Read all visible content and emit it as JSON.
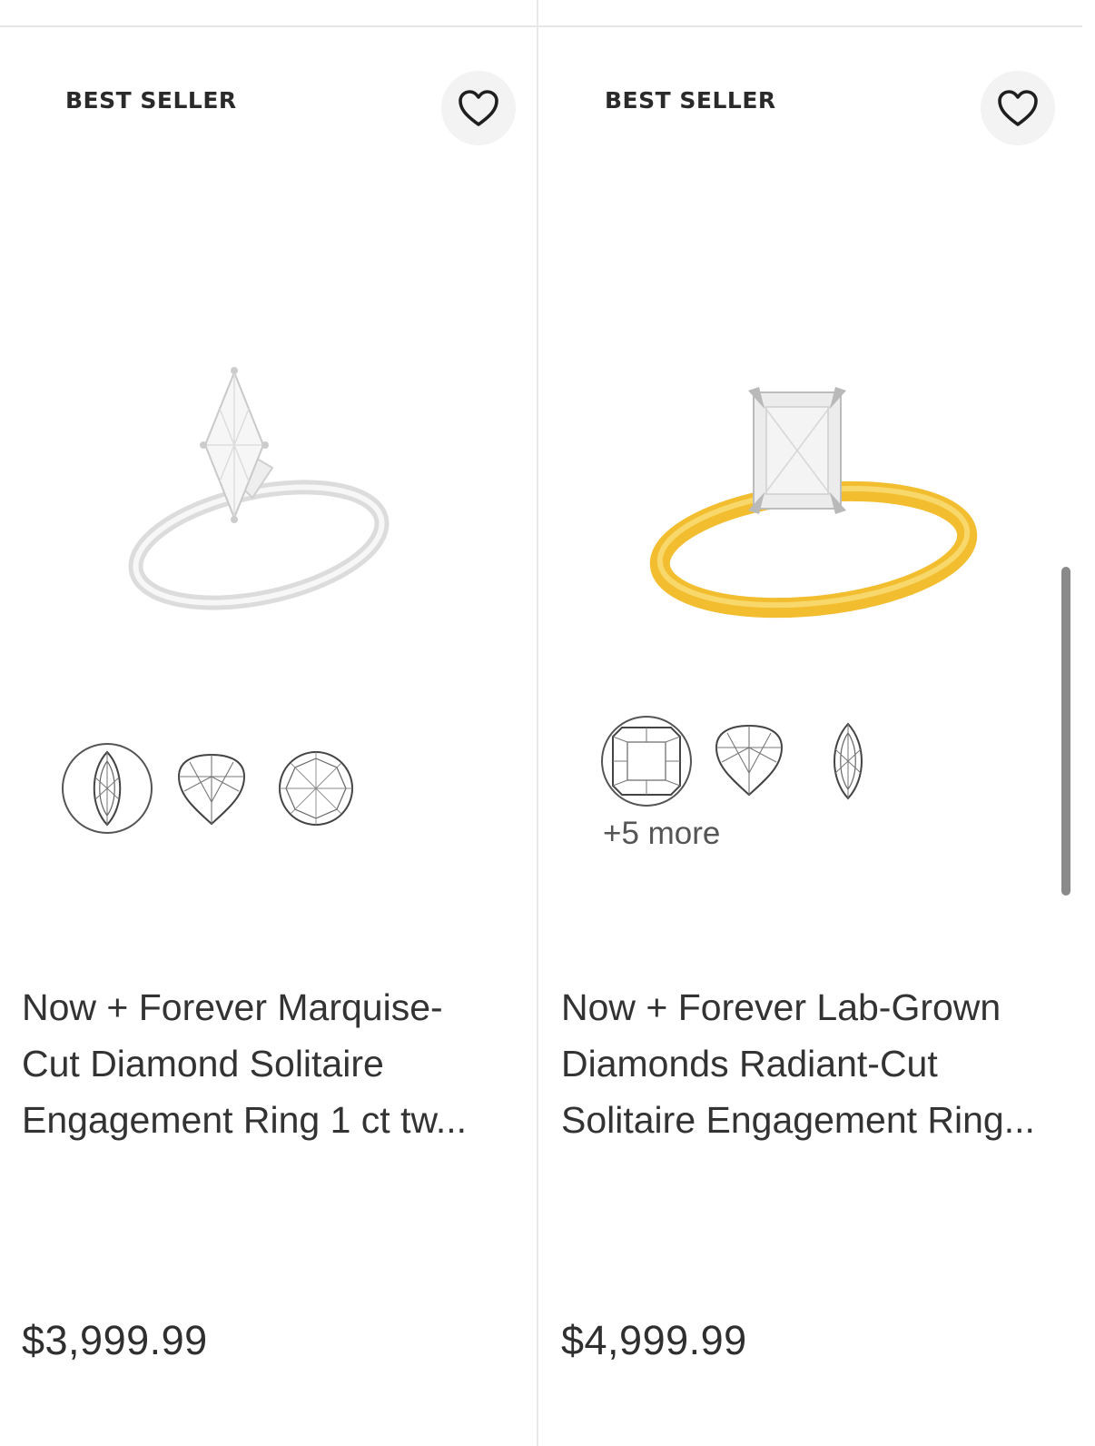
{
  "products": [
    {
      "badge": "BEST SELLER",
      "title_lines": [
        "Now + Forever Marquise-",
        "Cut Diamond Solitaire",
        "Engagement Ring 1 ct tw..."
      ],
      "price": "$3,999.99",
      "metal_color": "#e6e6e6",
      "shape_icons": [
        "marquise-icon",
        "pear-icon",
        "round-icon"
      ]
    },
    {
      "badge": "BEST SELLER",
      "title_lines": [
        "Now + Forever Lab-Grown",
        "Diamonds Radiant-Cut",
        "Solitaire Engagement Ring..."
      ],
      "price": "$4,999.99",
      "more_shapes": "+5 more",
      "metal_color": "#f2bd2e",
      "shape_icons": [
        "radiant-icon",
        "pear-icon",
        "marquise-icon"
      ]
    }
  ]
}
